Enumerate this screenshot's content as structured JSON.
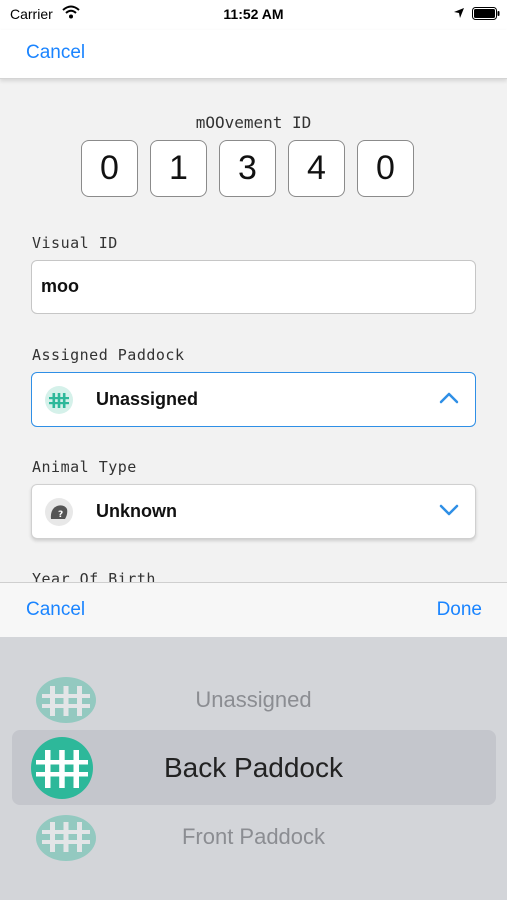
{
  "status_bar": {
    "carrier": "Carrier",
    "time": "11:52 AM"
  },
  "nav": {
    "cancel": "Cancel"
  },
  "movement_id": {
    "label": "mOOvement ID",
    "digits": [
      "0",
      "1",
      "3",
      "4",
      "0"
    ]
  },
  "visual_id": {
    "label": "Visual ID",
    "value": "moo"
  },
  "assigned_paddock": {
    "label": "Assigned Paddock",
    "value": "Unassigned"
  },
  "animal_type": {
    "label": "Animal Type",
    "value": "Unknown"
  },
  "year_of_birth": {
    "label": "Year Of Birth"
  },
  "picker_toolbar": {
    "cancel": "Cancel",
    "done": "Done"
  },
  "picker": {
    "options": [
      "Unassigned",
      "Back Paddock",
      "Front Paddock"
    ],
    "selected": "Back Paddock"
  },
  "colors": {
    "accent": "#1a84ff",
    "paddock_icon": "#2db89a",
    "focus_border": "#2f8fe6"
  }
}
